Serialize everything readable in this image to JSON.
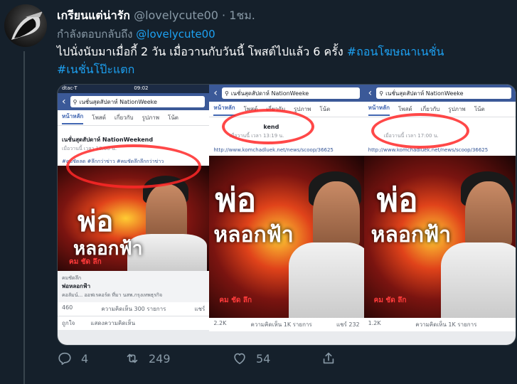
{
  "tweet": {
    "display_name": "เกรียนแต่น่ารัก",
    "handle": "@lovelycute00",
    "separator": "·",
    "time": "1ชม.",
    "reply_prefix": "กำลังตอบกลับถึง",
    "reply_to": "@lovelycute00",
    "text": "ไปนั่งนับมาเมื่อกี้  2 วัน เมื่อวานกับวันนี้ โพสต์ไปแล้ว 6 ครั้ง",
    "hashtags": [
      "#ถอนโฆษณาเนชั่น",
      "#เนชั่นโป๊ะแตก"
    ]
  },
  "media": {
    "panel1": {
      "status_carrier": "dtac-T",
      "status_time": "09:02",
      "search_text": "เนชั่นสุดสัปดาห์ NationWeeke",
      "tabs": [
        "หน้าหลัก",
        "โพสต์",
        "เกี่ยวกับ",
        "รูปภาพ",
        "โน้ต"
      ],
      "page_name": "เนชั่นสุดสัปดาห์ NationWeekend",
      "post_time": "เมื่อวานนี้ เวลา 10:00 น.",
      "tags": "#คมชัดลด #ลึกกว่าข่าว #คมชัดลึกลึกกว่าข่าว",
      "headline_1": "พ่อ",
      "headline_2": "หลอกฟ้า",
      "brand": "คม ชัด ลึก",
      "link_source": "คมชัดลึก",
      "link_title": "พ่อหลอกฟ้า",
      "link_sub": "คอลัมน์... ออฟเรคอร์ด ที่มา นสพ.กรุงเทพธุรกิจ",
      "reaction_count": "460",
      "comment_count": "ความคิดเห็น 300 รายการ",
      "share_label": "แชร์",
      "like_label": "ถูกใจ",
      "comment_label": "แสดงความคิดเห็น"
    },
    "panel2": {
      "search_text": "เนชั่นสุดสัปดาห์ NationWeeke",
      "tabs": [
        "หน้าหลัก",
        "โพสต์",
        "เกี่ยวกับ",
        "รูปภาพ",
        "โน้ต"
      ],
      "page_name": "kend",
      "post_time": "เมื่อวานนี้ เวลา 13:19 น.",
      "url": "http://www.komchadluek.net/news/scoop/36625",
      "headline_1": "พ่อ",
      "headline_2": "หลอกฟ้า",
      "brand": "คม ชัด ลึก",
      "reaction_count": "2.2K",
      "comment_count": "ความคิดเห็น 1K รายการ",
      "share_label": "แชร์ 232"
    },
    "panel3": {
      "search_text": "เนชั่นสุดสัปดาห์ NationWeeke",
      "tabs": [
        "หน้าหลัก",
        "โพสต์",
        "เกี่ยวกับ",
        "รูปภาพ",
        "โน้ต"
      ],
      "post_time": "เมื่อวานนี้ เวลา 17:00 น.",
      "url": "http://www.komchadluek.net/news/scoop/36625",
      "headline_1": "พ่อ",
      "headline_2": "หลอกฟ้า",
      "brand": "คม ชัด ลึก",
      "reaction_count": "1.2K",
      "comment_count": "ความคิดเห็น 1K รายการ"
    }
  },
  "actions": {
    "reply_count": "4",
    "retweet_count": "249",
    "like_count": "54"
  },
  "colors": {
    "background": "#15202b",
    "link": "#1da1f2",
    "muted": "#8899a6",
    "facebook_blue": "#3b5998",
    "annotation_red": "#ff2828"
  }
}
